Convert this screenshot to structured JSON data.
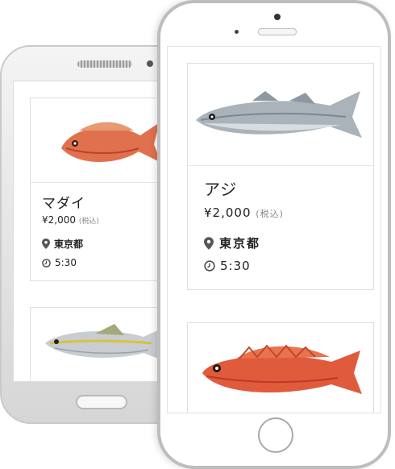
{
  "phones": {
    "android": {
      "card1": {
        "name": "マダイ",
        "price": "¥2,000",
        "tax": "(税込)",
        "location": "東京都",
        "time": "5:30",
        "fish_icon": "red-snapper-fish"
      },
      "card2": {
        "fish_icon": "yellowtail-fish"
      }
    },
    "iphone": {
      "card1": {
        "name": "アジ",
        "price": "¥2,000",
        "tax": "(税込)",
        "location": "東京都",
        "time": "5:30",
        "fish_icon": "sea-bass-fish"
      },
      "card2": {
        "fish_icon": "rockfish-fish"
      }
    }
  },
  "colors": {
    "text": "#222222",
    "muted": "#888888",
    "border": "#dedede",
    "pin": "#555555"
  }
}
